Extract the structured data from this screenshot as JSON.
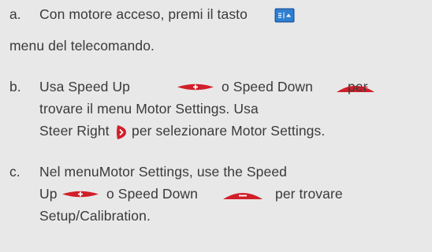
{
  "steps": [
    {
      "marker": "a.",
      "lines": [
        "Con motore acceso, premi il tasto",
        "menu  del telecomando."
      ]
    },
    {
      "marker": "b.",
      "line1_a": "Usa   Speed Up",
      "line1_b": "o  Speed Down",
      "line1_c": "per",
      "line2": "trovare il menu Motor Settings. Usa",
      "line3_a": "Steer Right",
      "line3_b": "per selezionare Motor Settings."
    },
    {
      "marker": "c.",
      "line1": "Nel menuMotor Settings, use the Speed",
      "line2_a": "Up",
      "line2_b": "o  Speed Down",
      "line2_c": "per trovare",
      "line3": "Setup/Calibration."
    }
  ],
  "icons": {
    "menu_button": "menu-button-icon",
    "speed_up": "speed-up-plus-icon",
    "speed_down": "speed-down-minus-icon",
    "steer_right": "steer-right-arrow-icon"
  },
  "colors": {
    "text": "#3a3a3a",
    "background": "#e8e8e8",
    "button_red": "#d11f2a",
    "menu_button_blue": "#1f6fc0"
  }
}
